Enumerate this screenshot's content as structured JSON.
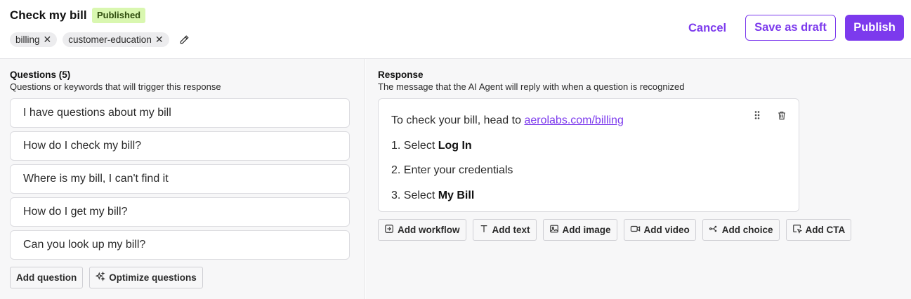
{
  "header": {
    "title": "Check my bill",
    "status_badge": "Published",
    "tags": [
      "billing",
      "customer-education"
    ],
    "tag_remove_glyph": "✕",
    "cancel_label": "Cancel",
    "draft_label": "Save as draft",
    "publish_label": "Publish",
    "accent_color": "#7c3aed",
    "badge_color": "#d9f7b0"
  },
  "questions": {
    "heading": "Questions (5)",
    "subheading": "Questions or keywords that will trigger this response",
    "items": [
      "I have questions about my bill",
      "How do I check my bill?",
      "Where is my bill, I can't find it",
      "How do I get my bill?",
      "Can you look up my bill?"
    ],
    "add_label": "Add question",
    "optimize_label": "Optimize questions",
    "optimize_icon": "sparkles-icon"
  },
  "response": {
    "heading": "Response",
    "subheading": "The message that the AI Agent will reply with when a question is recognized",
    "intro_text": "To check your bill, head to ",
    "link_text": "aerolabs.com/billing",
    "steps": [
      {
        "prefix": "1. Select ",
        "bold": "Log In"
      },
      {
        "prefix": "2. Enter your credentials",
        "bold": ""
      },
      {
        "prefix": "3. Select ",
        "bold": "My Bill"
      }
    ],
    "toolbar": [
      {
        "label": "Add workflow",
        "icon": "workflow-icon"
      },
      {
        "label": "Add text",
        "icon": "text-icon"
      },
      {
        "label": "Add image",
        "icon": "image-icon"
      },
      {
        "label": "Add video",
        "icon": "video-icon"
      },
      {
        "label": "Add choice",
        "icon": "choice-icon"
      },
      {
        "label": "Add CTA",
        "icon": "cta-icon"
      }
    ]
  }
}
